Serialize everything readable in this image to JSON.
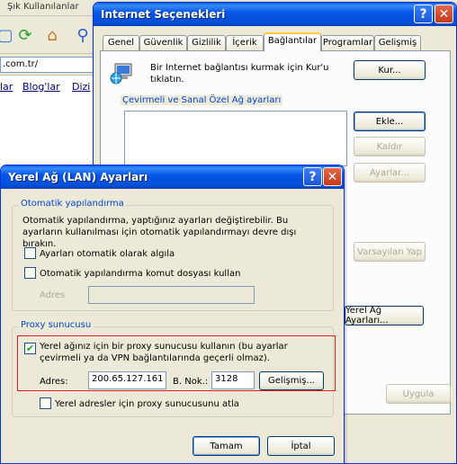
{
  "browser": {
    "bookmark_text": "Şık Kullanılanlar",
    "address_text": ".com.tr/",
    "links": [
      "lar",
      "Blog'lar",
      "Dizi"
    ]
  },
  "options_window": {
    "title": "Internet Seçenekleri",
    "tabs": [
      "Genel",
      "Güvenlik",
      "Gizlilik",
      "İçerik",
      "Bağlantılar",
      "Programlar",
      "Gelişmiş"
    ],
    "active_tab": "Bağlantılar",
    "setup_text": "Bir Internet bağlantısı kurmak için Kur'u tıklatın.",
    "setup_button": "Kur...",
    "dialup_group_label": "Çevirmeli ve Sanal Özel Ağ ayarları",
    "add_button": "Ekle...",
    "remove_button": "Kaldır",
    "settings_button": "Ayarlar...",
    "default_button": "Varsayılan Yap",
    "lan_button": "Yerel Ağ Ayarları...",
    "apply_button": "Uygula"
  },
  "lan_dialog": {
    "title": "Yerel Ağ (LAN) Ayarları",
    "auto_group_label": "Otomatik yapılandırma",
    "auto_desc": "Otomatik yapılandırma, yaptığınız ayarları değiştirebilir. Bu ayarların kullanılması için otomatik yapılandırmayı devre dışı bırakın.",
    "auto_detect_label": "Ayarları otomatik olarak algıla",
    "auto_script_label": "Otomatik yapılandırma komut dosyası kullan",
    "script_address_label": "Adres",
    "script_address_value": "",
    "proxy_group_label": "Proxy sunucusu",
    "use_proxy_label": "Yerel ağınız için bir proxy sunucusu kullanın (bu ayarlar çevirmeli ya da VPN bağlantılarında geçerli olmaz).",
    "use_proxy_checked": true,
    "auto_detect_checked": false,
    "auto_script_checked": false,
    "bypass_checked": false,
    "address_label": "Adres:",
    "address_value": "200.65.127.161",
    "port_label": "B. Nok.:",
    "port_value": "3128",
    "advanced_button": "Gelişmiş...",
    "bypass_label": "Yerel adresler için proxy sunucusunu atla",
    "ok_button": "Tamam",
    "cancel_button": "İptal",
    "highlight_color": "#e02020"
  }
}
